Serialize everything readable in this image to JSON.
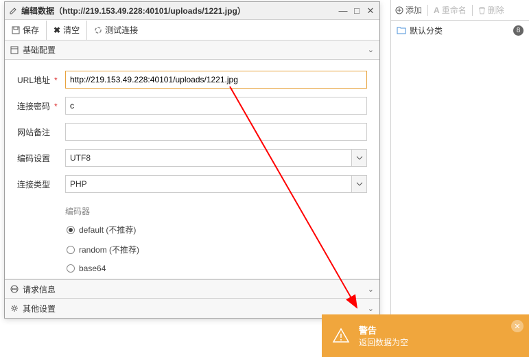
{
  "right_panel": {
    "add": "添加",
    "rename": "重命名",
    "delete": "删除",
    "default_category": "默认分类",
    "badge": "8"
  },
  "dialog": {
    "title": "编辑数据（http://219.153.49.228:40101/uploads/1221.jpg）",
    "toolbar": {
      "save": "保存",
      "clear": "清空",
      "test": "测试连接"
    },
    "sections": {
      "basic": "基础配置",
      "request": "请求信息",
      "other": "其他设置"
    },
    "form": {
      "url_label": "URL地址",
      "url_value": "http://219.153.49.228:40101/uploads/1221.jpg",
      "pwd_label": "连接密码",
      "pwd_value": "c",
      "remark_label": "网站备注",
      "remark_value": "",
      "encode_label": "编码设置",
      "encode_value": "UTF8",
      "type_label": "连接类型",
      "type_value": "PHP",
      "encoder_label": "编码器",
      "opt_default": "default (不推荐)",
      "opt_random": "random (不推荐)",
      "opt_base64": "base64"
    }
  },
  "toast": {
    "title": "警告",
    "message": "返回数据为空"
  }
}
